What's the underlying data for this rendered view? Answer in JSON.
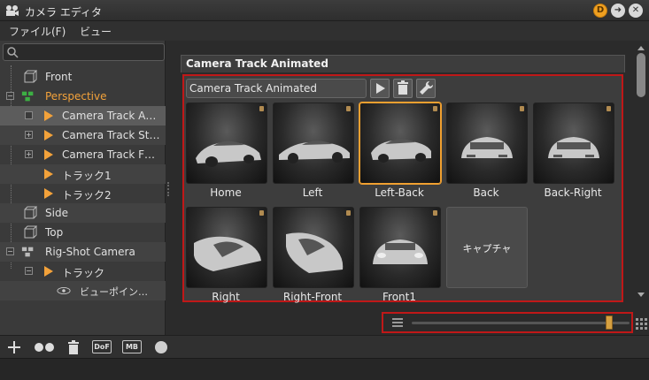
{
  "window": {
    "title": "カメラ エディタ",
    "d_badge": "D"
  },
  "menu": {
    "file": "ファイル(F)",
    "view": "ビュー"
  },
  "tree": {
    "front": "Front",
    "perspective": "Perspective",
    "cam_track_a": "Camera Track A…",
    "cam_track_st": "Camera Track St…",
    "cam_track_f": "Camera Track F…",
    "track1": "トラック1",
    "track2": "トラック2",
    "side": "Side",
    "top": "Top",
    "rig_shot": "Rig-Shot Camera",
    "track": "トラック",
    "viewpoint": "ビューポイン…"
  },
  "panel": {
    "title": "Camera Track Animated",
    "name_value": "Camera Track Animated"
  },
  "thumbnails": [
    {
      "label": "Home"
    },
    {
      "label": "Left"
    },
    {
      "label": "Left-Back"
    },
    {
      "label": "Back"
    },
    {
      "label": "Back-Right"
    },
    {
      "label": "Right"
    },
    {
      "label": "Right-Front"
    },
    {
      "label": "Front1"
    }
  ],
  "capture_label": "キャプチャ",
  "zoom": {
    "level": 0.92
  },
  "bottom": {
    "dof": "DoF",
    "mb": "MB"
  },
  "colors": {
    "accent": "#f3a23a",
    "highlight_frame": "#c01818",
    "selection": "#5c5c5c"
  }
}
